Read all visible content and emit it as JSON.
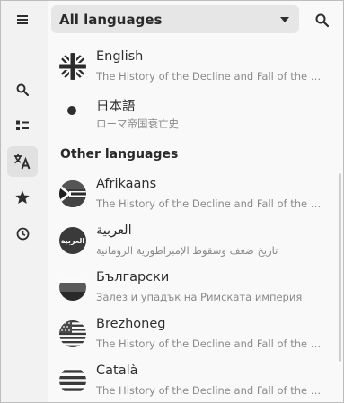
{
  "header": {
    "language_select_label": "All languages"
  },
  "section": {
    "other_languages": "Other languages"
  },
  "languages": [
    {
      "name": "English",
      "subtitle": "The History of the Decline and Fall of the Roman Empire",
      "icon": "uk-flag-icon"
    },
    {
      "name": "日本語",
      "subtitle": "ローマ帝国衰亡史",
      "icon": "dot-icon"
    },
    {
      "name": "Afrikaans",
      "subtitle": "The History of the Decline and Fall of the Roman Empire",
      "icon": "south-africa-flag-icon"
    },
    {
      "name": "العربية",
      "subtitle": "تاريخ ضعف وسقوط الإمبراطورية الرومانية",
      "icon": "arabic-badge-icon",
      "icon_text": "العربية"
    },
    {
      "name": "Български",
      "subtitle": "Залез и упадък на Римската империя",
      "icon": "bulgaria-flag-icon"
    },
    {
      "name": "Brezhoneg",
      "subtitle": "The History of the Decline and Fall of the Roman Empire",
      "icon": "us-flag-icon"
    },
    {
      "name": "Català",
      "subtitle": "The History of the Decline and Fall of the Roman Empire",
      "icon": "catalonia-flag-icon"
    }
  ],
  "rail_icons": [
    "menu-icon",
    "search-icon",
    "list-icon",
    "translate-icon",
    "star-icon",
    "history-icon"
  ],
  "colors": {
    "background": "#f9f9f9",
    "rail": "#f2f2f2",
    "select": "#e6e6e6",
    "active": "#e1e1e1",
    "subtitle": "#8a8a8a"
  }
}
